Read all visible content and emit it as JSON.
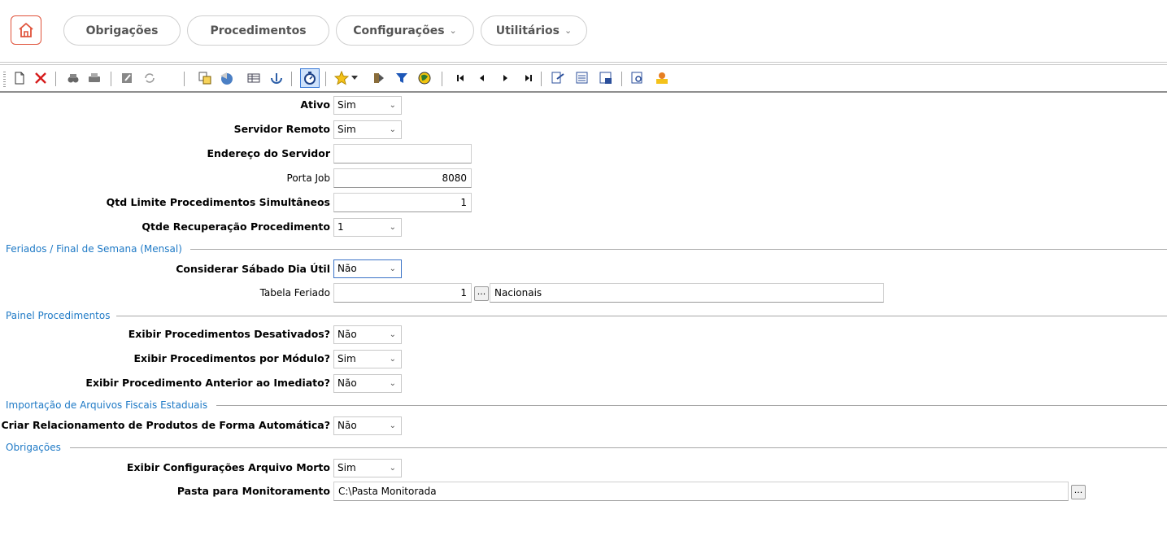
{
  "nav": {
    "items": [
      {
        "label": "Obrigações",
        "dropdown": false
      },
      {
        "label": "Procedimentos",
        "dropdown": false
      },
      {
        "label": "Configurações",
        "dropdown": true
      },
      {
        "label": "Utilitários",
        "dropdown": true
      }
    ],
    "accent": "#e0523a"
  },
  "toolbar": {
    "icons": [
      "new-document-icon",
      "delete-icon",
      "find-icon",
      "print-icon",
      "edit-icon",
      "refresh-icon",
      "copy-icon",
      "globe-icon",
      "grid-icon",
      "info-icon",
      "timer-icon",
      "star-icon",
      "export-icon",
      "filter-icon",
      "world-icon",
      "first-record-icon",
      "previous-record-icon",
      "next-record-icon",
      "last-record-icon",
      "report-icon",
      "list-report-icon",
      "sheet-icon",
      "preview-icon",
      "user-icon"
    ]
  },
  "form": {
    "ativo": {
      "label": "Ativo",
      "value": "Sim"
    },
    "servidor_remoto": {
      "label": "Servidor Remoto",
      "value": "Sim"
    },
    "endereco_servidor": {
      "label": "Endereço do Servidor",
      "value": ""
    },
    "porta_job": {
      "label": "Porta Job",
      "value": "8080"
    },
    "qtd_limite": {
      "label": "Qtd Limite Procedimentos Simultâneos",
      "value": "1"
    },
    "qtde_recuperacao": {
      "label": "Qtde Recuperação Procedimento",
      "value": "1"
    },
    "section_feriados": "Feriados / Final de Semana (Mensal)",
    "considerar_sabado": {
      "label": "Considerar Sábado Dia Útil",
      "value": "Não"
    },
    "tabela_feriado": {
      "label": "Tabela Feriado",
      "value": "1",
      "button": "...",
      "description": "Nacionais"
    },
    "section_painel": "Painel Procedimentos",
    "exibir_desativados": {
      "label": "Exibir Procedimentos Desativados?",
      "value": "Não"
    },
    "exibir_por_modulo": {
      "label": "Exibir Procedimentos por Módulo?",
      "value": "Sim"
    },
    "exibir_anterior": {
      "label": "Exibir Procedimento Anterior ao Imediato?",
      "value": "Não"
    },
    "section_importacao": "Importação de Arquivos Fiscais Estaduais",
    "criar_relacionamento": {
      "label": "Criar Relacionamento de Produtos de Forma Automática?",
      "value": "Não"
    },
    "section_obrigacoes": "Obrigações",
    "exibir_arquivo_morto": {
      "label": "Exibir Configurações Arquivo Morto",
      "value": "Sim"
    },
    "pasta_monitoramento": {
      "label": "Pasta para Monitoramento",
      "value": "C:\\Pasta Monitorada",
      "button": "..."
    }
  }
}
